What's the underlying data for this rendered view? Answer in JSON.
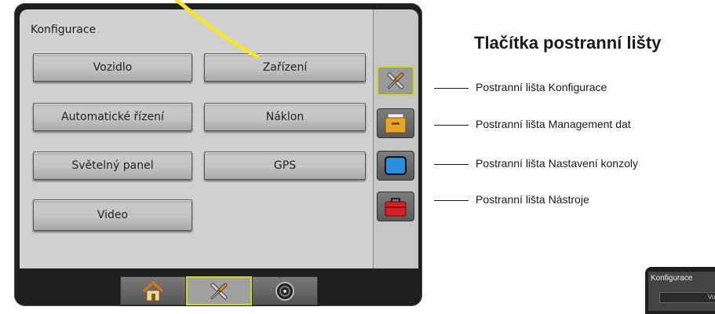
{
  "screen": {
    "title": "Konfigurace",
    "buttons": {
      "vehicle": "Vozidlo",
      "implement": "Zařízení",
      "auto_steering": "Automatické řízení",
      "tilt": "Náklon",
      "lightbar": "Světelný panel",
      "gps": "GPS",
      "video": "Video"
    }
  },
  "sidebar": {
    "items": [
      {
        "icon": "wrench-screwdriver-icon",
        "active": true
      },
      {
        "icon": "file-drawer-icon",
        "active": false
      },
      {
        "icon": "monitor-icon",
        "active": false
      },
      {
        "icon": "toolbox-icon",
        "active": false
      }
    ]
  },
  "bottombar": {
    "items": [
      {
        "icon": "home-icon",
        "active": false
      },
      {
        "icon": "wrench-screwdriver-icon",
        "active": true
      },
      {
        "icon": "gauge-icon",
        "active": false
      }
    ]
  },
  "callouts": {
    "heading": "Tlačítka postranní lišty",
    "items": [
      "Postranní lišta Konfigurace",
      "Postranní lišta Management dat",
      "Postranní lišta Nastavení konzoly",
      "Postranní lišta Nástroje"
    ]
  },
  "thumbnail": {
    "title": "Konfigurace",
    "button_partial": "Vozi"
  },
  "colors": {
    "active_highlight": "#c9d92a",
    "arrow_yellow": "#f2e62a",
    "screen_bg": "#d0d0d0",
    "bezel": "#1e1e1e"
  }
}
